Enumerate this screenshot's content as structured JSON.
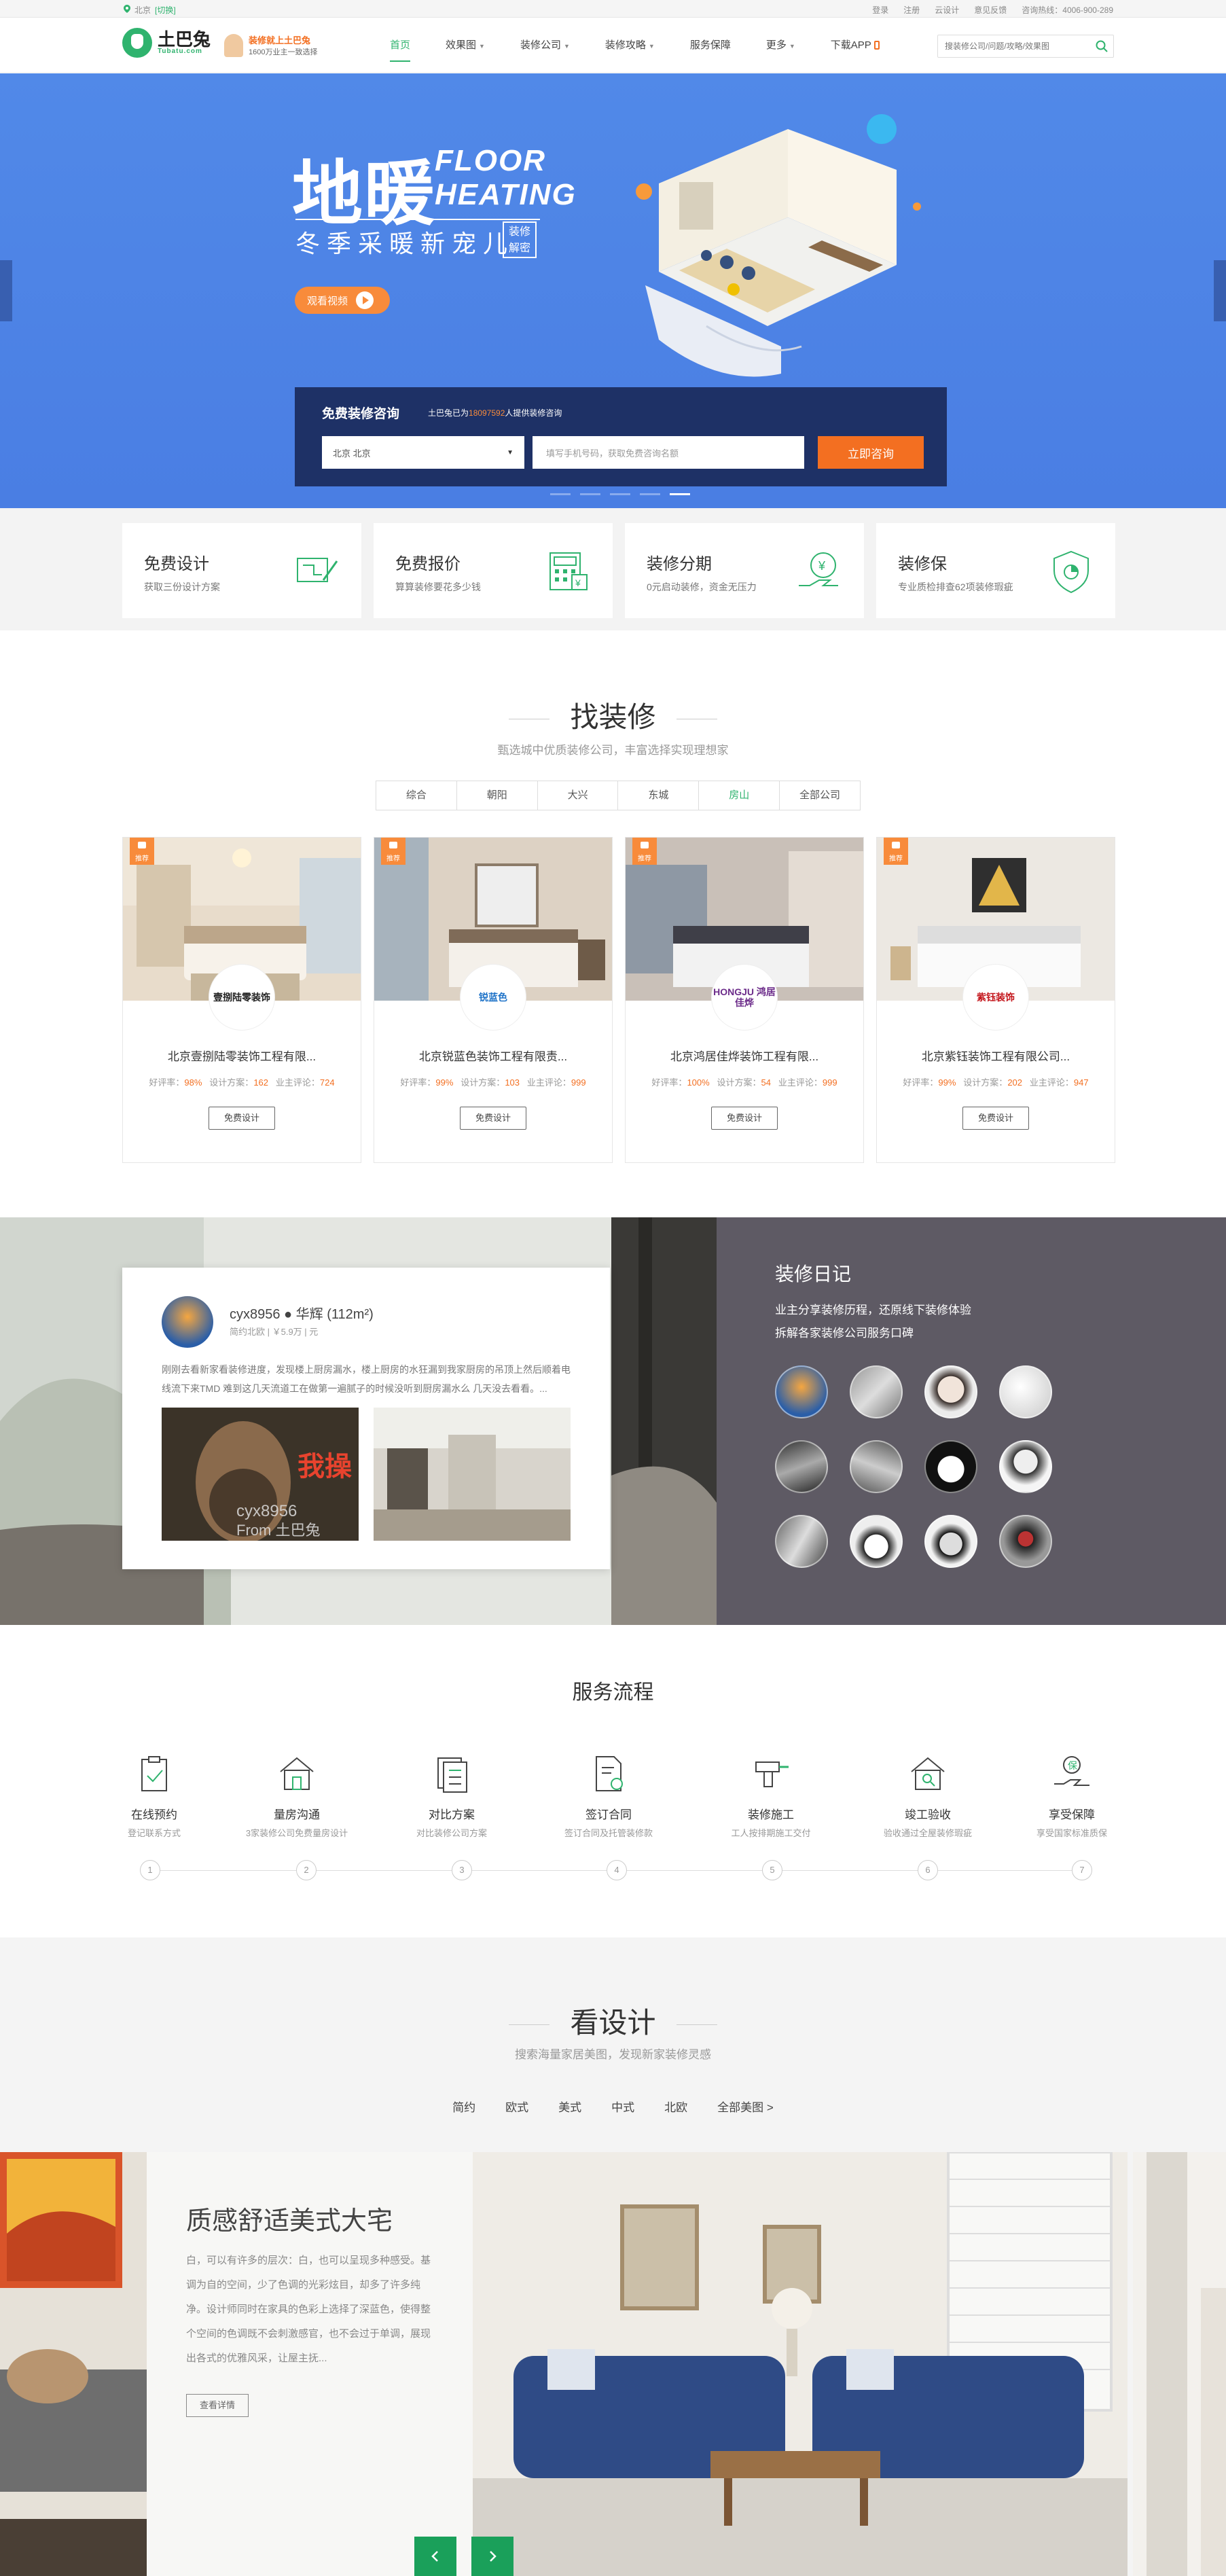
{
  "topbar": {
    "city": "北京",
    "switch": "[切换]",
    "links": [
      "登录",
      "注册",
      "云设计",
      "意见反馈",
      "咨询热线：4006-900-289"
    ]
  },
  "nav": {
    "logo_cn": "土巴兔",
    "logo_en": "Tubatu.com",
    "promo_title": "装修就上土巴兔",
    "promo_sub": "1600万业主一致选择",
    "menu": [
      {
        "label": "首页",
        "active": true,
        "dropdown": false
      },
      {
        "label": "效果图",
        "dropdown": true
      },
      {
        "label": "装修公司",
        "dropdown": true
      },
      {
        "label": "装修攻略",
        "dropdown": true
      },
      {
        "label": "服务保障",
        "dropdown": false
      },
      {
        "label": "更多",
        "dropdown": true
      },
      {
        "label": "下载APP",
        "dropdown": false
      }
    ],
    "search_placeholder": "搜装修公司/问题/攻略/效果图"
  },
  "hero": {
    "title_cn": "地暖",
    "title_en_1": "FLOOR",
    "title_en_2": "HEATING",
    "subtitle": "冬季采暖新宠儿",
    "badge": "装修解密",
    "video_button": "观看视频",
    "consult": {
      "title": "免费装修咨询",
      "sub_prefix": "土巴兔已为",
      "sub_number": "18097592",
      "sub_suffix": "人提供装修咨询",
      "select_value": "北京 北京",
      "input_placeholder": "填写手机号码，获取免费咨询名额",
      "button": "立即咨询"
    },
    "slides": 5,
    "active_slide": 5
  },
  "features": [
    {
      "title": "免费设计",
      "desc": "获取三份设计方案",
      "icon": "blueprint-icon"
    },
    {
      "title": "免费报价",
      "desc": "算算装修要花多少钱",
      "icon": "calculator-icon"
    },
    {
      "title": "装修分期",
      "desc": "0元启动装修，资金无压力",
      "icon": "installment-icon"
    },
    {
      "title": "装修保",
      "desc": "专业质检排查62项装修瑕疵",
      "icon": "shield-icon"
    }
  ],
  "find": {
    "title": "找装修",
    "subtitle": "甄选城中优质装修公司，丰富选择实现理想家",
    "tabs": [
      {
        "label": "综合"
      },
      {
        "label": "朝阳"
      },
      {
        "label": "大兴"
      },
      {
        "label": "东城"
      },
      {
        "label": "房山",
        "active": true
      },
      {
        "label": "全部公司"
      }
    ],
    "companies": [
      {
        "name": "北京壹捌陆零装饰工程有限...",
        "logo_text": "壹捌陆零装饰",
        "good_label": "好评率：",
        "good": "98%",
        "plans_label": "设计方案：",
        "plans": "162",
        "reviews_label": "业主评论：",
        "reviews": "724",
        "button": "免费设计",
        "tag": "推荐"
      },
      {
        "name": "北京锐蓝色装饰工程有限责...",
        "logo_text": "锐蓝色",
        "good_label": "好评率：",
        "good": "99%",
        "plans_label": "设计方案：",
        "plans": "103",
        "reviews_label": "业主评论：",
        "reviews": "999",
        "button": "免费设计",
        "tag": "推荐"
      },
      {
        "name": "北京鸿居佳烨装饰工程有限...",
        "logo_text": "HONGJU 鸿居佳烨",
        "good_label": "好评率：",
        "good": "100%",
        "plans_label": "设计方案：",
        "plans": "54",
        "reviews_label": "业主评论：",
        "reviews": "999",
        "button": "免费设计",
        "tag": "推荐"
      },
      {
        "name": "北京紫钰装饰工程有限公司...",
        "logo_text": "紫钰装饰",
        "good_label": "好评率：",
        "good": "99%",
        "plans_label": "设计方案：",
        "plans": "202",
        "reviews_label": "业主评论：",
        "reviews": "947",
        "button": "免费设计",
        "tag": "推荐"
      }
    ]
  },
  "diary": {
    "title": "装修日记",
    "desc_1": "业主分享装修历程，还原线下装修体验",
    "desc_2": "拆解各家装修公司服务口碑",
    "card": {
      "user": "cyx8956 ● 华辉 (112m²)",
      "meta": "简约北欧 | ￥5.9万 | 元",
      "text": "刚刚去看新家看装修进度，发现楼上厨房漏水，楼上厨房的水狂漏到我家厨房的吊顶上然后顺着电线流下来TMD 难到这几天流道工在做第一遍腻子的时候没听到厨房漏水么 几天没去看看。...",
      "watermark_1": "cyx8956",
      "watermark_2": "From 土巴兔",
      "sticker": "我操"
    }
  },
  "process": {
    "title": "服务流程",
    "steps": [
      {
        "title": "在线预约",
        "desc": "登记联系方式",
        "num": "1",
        "icon": "clipboard-check-icon"
      },
      {
        "title": "量房沟通",
        "desc": "3家装修公司免费量房设计",
        "num": "2",
        "icon": "house-measure-icon"
      },
      {
        "title": "对比方案",
        "desc": "对比装修公司方案",
        "num": "3",
        "icon": "compare-list-icon"
      },
      {
        "title": "签订合同",
        "desc": "签订合同及托管装修款",
        "num": "4",
        "icon": "contract-icon"
      },
      {
        "title": "装修施工",
        "desc": "工人按排期施工交付",
        "num": "5",
        "icon": "drill-icon"
      },
      {
        "title": "竣工验收",
        "desc": "验收通过全屋装修瑕疵",
        "num": "6",
        "icon": "house-search-icon"
      },
      {
        "title": "享受保障",
        "desc": "享受国家标准质保",
        "num": "7",
        "icon": "guarantee-hand-icon"
      }
    ]
  },
  "design": {
    "title": "看设计",
    "subtitle": "搜索海量家居美图，发现新家装修灵感",
    "tabs": [
      "简约",
      "欧式",
      "美式",
      "中式",
      "北欧",
      "全部美图 >"
    ],
    "showcase": {
      "title": "质感舒适美式大宅",
      "desc": "白，可以有许多的层次：白，也可以呈现多种感受。基调为自的空间，少了色调的光彩炫目，却多了许多纯净。设计师同时在家具的色彩上选择了深蓝色，使得整个空间的色调既不会刺激感官，也不会过于单调，展现出各式的优雅风采，让屋主抚...",
      "button": "查看详情"
    }
  },
  "colors": {
    "brand": "#2fb36e",
    "accent": "#f36f21",
    "hero_bg": "#4a7ee3",
    "consult_bg": "#1e3166",
    "diary_panel": "#5e5a64"
  }
}
